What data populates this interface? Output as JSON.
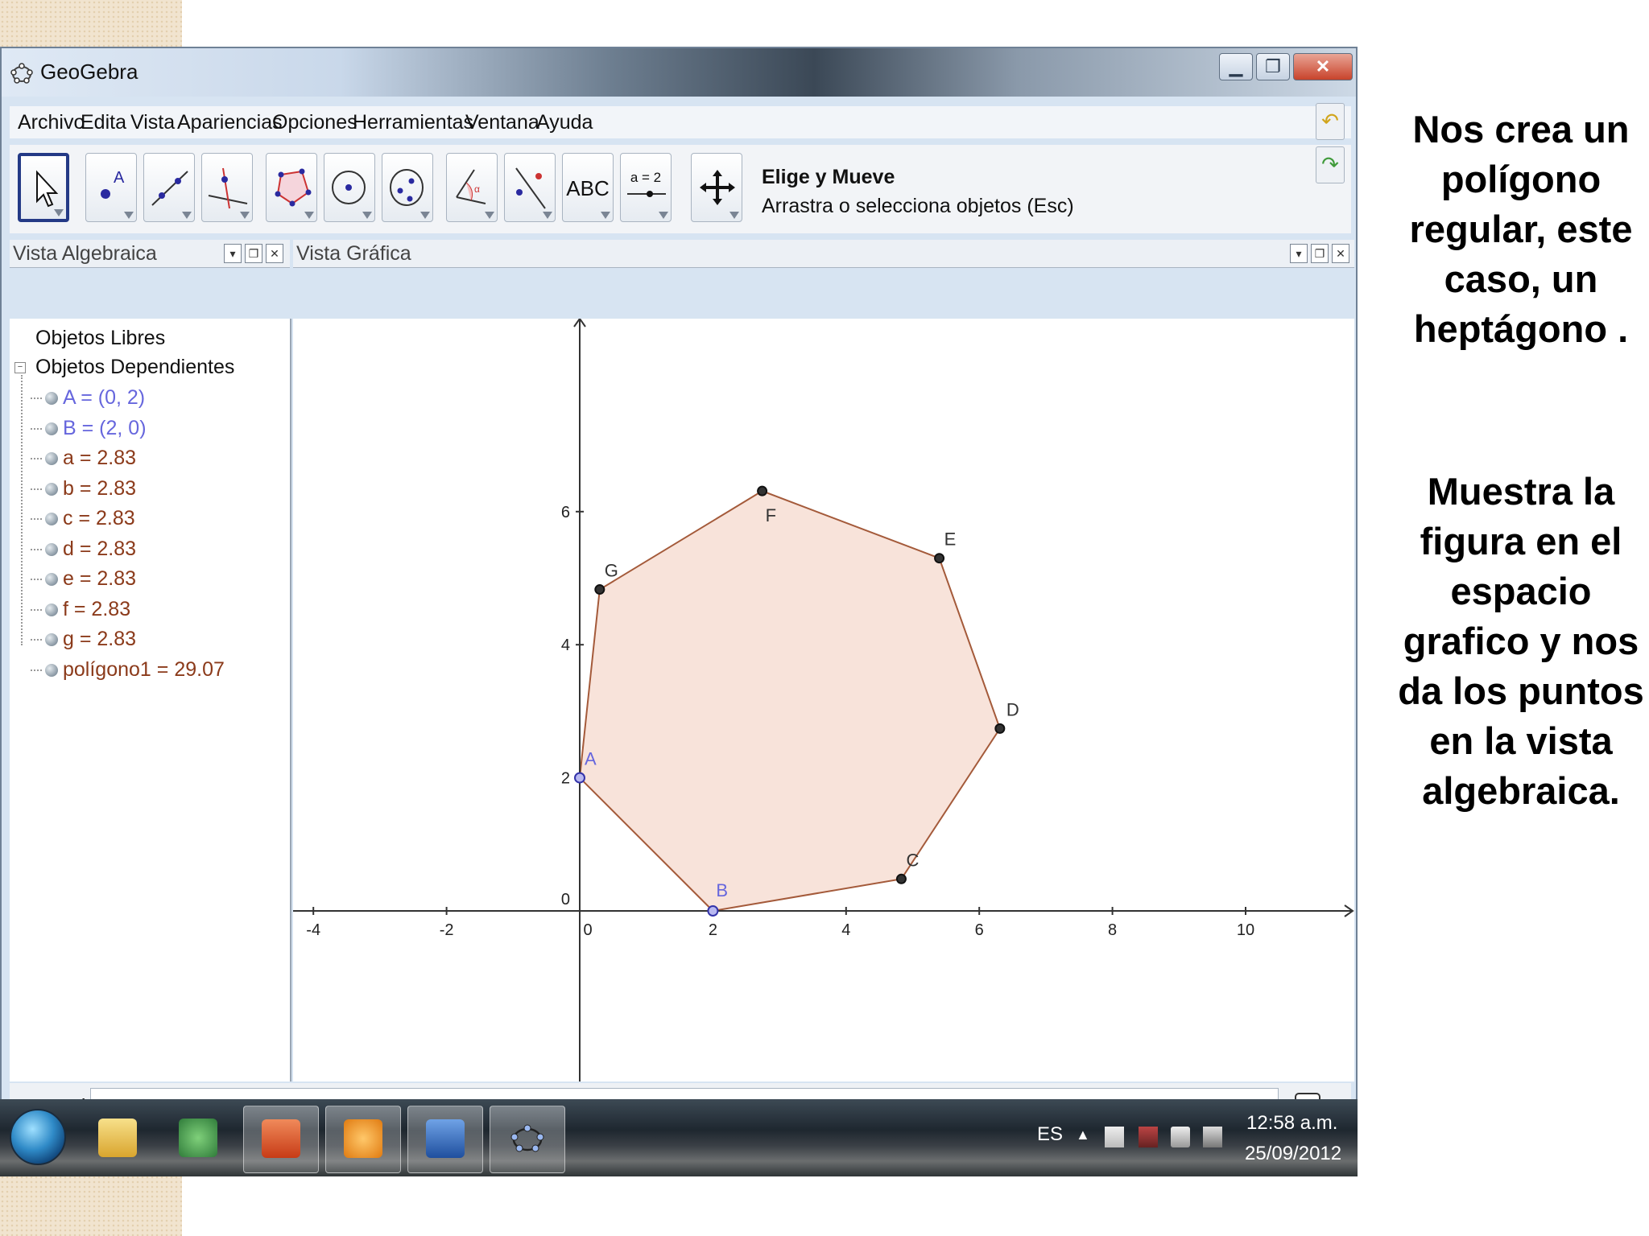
{
  "window": {
    "title": "GeoGebra"
  },
  "menu": [
    "Archivo",
    "Edita",
    "Vista",
    "Apariencias",
    "Opciones",
    "Herramientas",
    "Ventana",
    "Ayuda"
  ],
  "toolbar": {
    "tool_title": "Elige y Mueve",
    "tool_help": "Arrastra o selecciona objetos (Esc)",
    "text_tool_label": "ABC",
    "slider_tool_label": "a = 2"
  },
  "algebra_view": {
    "title": "Vista Algebraica",
    "free_objects": "Objetos Libres",
    "dependent_objects": "Objetos Dependientes",
    "items": [
      {
        "text": "A = (0, 2)",
        "color": "#6666dd"
      },
      {
        "text": "B = (2, 0)",
        "color": "#6666dd"
      },
      {
        "text": "a = 2.83",
        "color": "#8b3a1a"
      },
      {
        "text": "b = 2.83",
        "color": "#8b3a1a"
      },
      {
        "text": "c = 2.83",
        "color": "#8b3a1a"
      },
      {
        "text": "d = 2.83",
        "color": "#8b3a1a"
      },
      {
        "text": "e = 2.83",
        "color": "#8b3a1a"
      },
      {
        "text": "f = 2.83",
        "color": "#8b3a1a"
      },
      {
        "text": "g = 2.83",
        "color": "#8b3a1a"
      },
      {
        "text": "polígono1 = 29.07",
        "color": "#8b3a1a"
      }
    ]
  },
  "graphics_view": {
    "title": "Vista Gráfica",
    "x_ticks": [
      "-4",
      "-2",
      "0",
      "2",
      "4",
      "6",
      "8",
      "10"
    ],
    "y_ticks": [
      "0",
      "2",
      "4",
      "6"
    ],
    "polygon_fill": "#f8e3da",
    "polygon_stroke": "#a45a3a",
    "points": [
      {
        "label": "A",
        "x": 0,
        "y": 2,
        "free": true
      },
      {
        "label": "B",
        "x": 2,
        "y": 0,
        "free": true
      },
      {
        "label": "C",
        "x": 4.83,
        "y": 0.48
      },
      {
        "label": "D",
        "x": 6.31,
        "y": 2.74
      },
      {
        "label": "E",
        "x": 5.4,
        "y": 5.3
      },
      {
        "label": "F",
        "x": 2.74,
        "y": 6.31
      },
      {
        "label": "G",
        "x": 0.3,
        "y": 4.83
      }
    ]
  },
  "input_bar": {
    "label": "Entrada:",
    "value": ""
  },
  "taskbar": {
    "language": "ES",
    "time": "12:58 a.m.",
    "date": "25/09/2012"
  },
  "side_text": {
    "paragraph1": "Nos crea un polígono regular, este caso, un heptágono .",
    "paragraph2": "Muestra la figura en el espacio grafico y nos da los puntos en la vista algebraica."
  }
}
